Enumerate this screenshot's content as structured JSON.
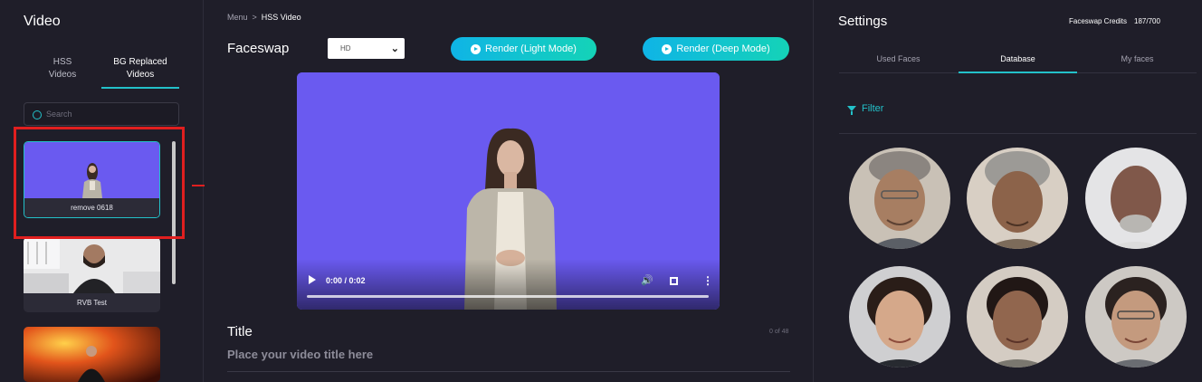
{
  "left": {
    "title": "Video",
    "tabs": [
      {
        "line1": "HSS",
        "line2": "Videos"
      },
      {
        "line1": "BG Replaced",
        "line2": "Videos"
      }
    ],
    "active_tab": 1,
    "search_placeholder": "Search",
    "videos": [
      {
        "label": "remove 0618",
        "selected": true
      },
      {
        "label": "RVB Test",
        "selected": false
      },
      {
        "label": "",
        "selected": false
      }
    ]
  },
  "main": {
    "breadcrumb": {
      "menu": "Menu",
      "separator": ">",
      "current": "HSS Video"
    },
    "title": "Faceswap",
    "quality": {
      "selected": "HD"
    },
    "buttons": {
      "light": "Render (Light Mode)",
      "deep": "Render (Deep Mode)"
    },
    "player": {
      "time": "0:00 / 0:02"
    },
    "video_title": {
      "label": "Title",
      "placeholder": "Place your video title here",
      "counter": "0 of 48"
    }
  },
  "settings": {
    "title": "Settings",
    "credits_label": "Faceswap Credits",
    "credits_value": "187/700",
    "tabs": [
      "Used Faces",
      "Database",
      "My faces"
    ],
    "active_tab": 1,
    "filter_label": "Filter",
    "faces_count": 6
  },
  "colors": {
    "accent": "#23c1c9",
    "bg": "#1f1e29",
    "video_bg": "#6a5af0",
    "annotation": "#e01f1f"
  },
  "icons": [
    "search-icon",
    "chevron-down-icon",
    "play-icon",
    "volume-icon",
    "fullscreen-icon",
    "more-icon",
    "filter-icon"
  ]
}
